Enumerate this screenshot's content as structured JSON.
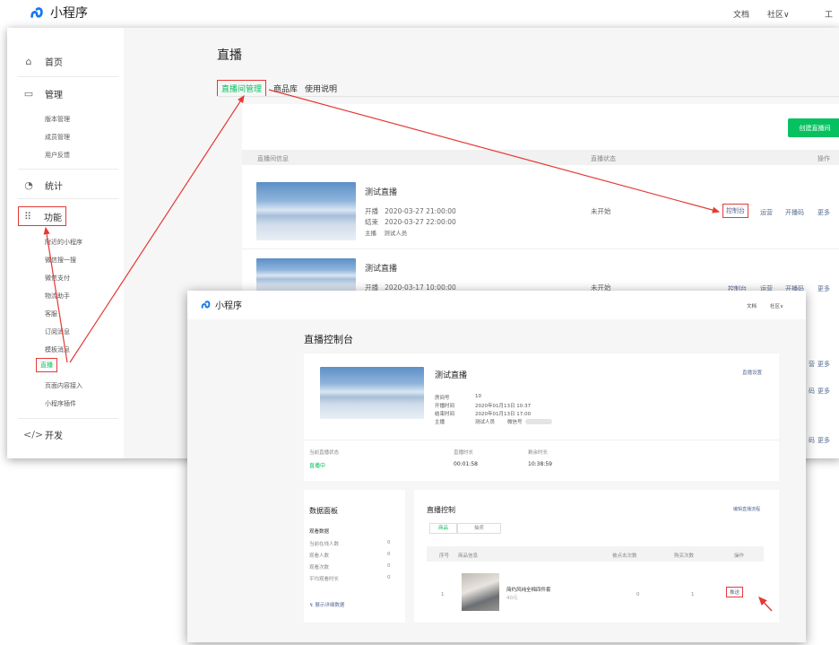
{
  "topbar": {
    "app_name": "小程序",
    "links": [
      "文档",
      "社区∨",
      "工"
    ]
  },
  "sidebar": {
    "home": "首页",
    "manage": "管理",
    "manage_items": [
      "版本管理",
      "成员管理",
      "用户反馈"
    ],
    "stats": "统计",
    "features": "功能",
    "feature_items": [
      "附近的小程序",
      "微信搜一搜",
      "微信支付",
      "物流助手",
      "客服",
      "订阅消息",
      "模板消息",
      "直播",
      "页面内容接入",
      "小程序插件"
    ],
    "dev": "开发"
  },
  "main": {
    "title": "直播",
    "tabs": [
      "直播间管理",
      "商品库",
      "使用说明"
    ],
    "create_button": "创建直播间",
    "table_headers": [
      "直播间信息",
      "直播状态",
      "操作"
    ],
    "rows": [
      {
        "name": "测试直播",
        "start_label": "开播",
        "start": "2020-03-27 21:00:00",
        "end_label": "结束",
        "end": "2020-03-27 22:00:00",
        "host_label": "主播",
        "host": "测试人员",
        "status": "未开始",
        "actions": [
          "控制台",
          "运营",
          "开播码",
          "更多"
        ]
      },
      {
        "name": "测试直播",
        "start_label": "开播",
        "start": "2020-03-17 10:00:00",
        "status": "未开始",
        "actions": [
          "控制台",
          "运营",
          "开播码",
          "更多"
        ]
      }
    ],
    "more_partial": [
      "更多",
      "更多",
      "更多"
    ],
    "op_partial": [
      "营",
      "码",
      "码"
    ]
  },
  "console": {
    "app_name": "小程序",
    "links": [
      "文档",
      "社区∨"
    ],
    "title": "直播控制台",
    "live_name": "测试直播",
    "settings_link": "直播设置",
    "info": [
      {
        "k": "房间号",
        "v": "10"
      },
      {
        "k": "开播时间",
        "v": "2020年01月13日 10:37"
      },
      {
        "k": "结束时间",
        "v": "2020年01月13日 17:00"
      },
      {
        "k": "主播",
        "v": "测试人员"
      }
    ],
    "wechat_label": "微信号",
    "stats": [
      {
        "k": "当前直播状态",
        "v": "直播中"
      },
      {
        "k": "直播时长",
        "v": "00:01:58"
      },
      {
        "k": "剩余时长",
        "v": "10:38:59"
      }
    ],
    "data_panel": {
      "title": "数据面板",
      "subtitle": "观看数据",
      "rows": [
        {
          "k": "当前在线人数",
          "v": "0"
        },
        {
          "k": "观看人数",
          "v": "0"
        },
        {
          "k": "观看次数",
          "v": "0"
        },
        {
          "k": "平均观看时长",
          "v": "0"
        }
      ],
      "more": "展示详细数据"
    },
    "control": {
      "title": "直播控制",
      "link": "编辑直播流程",
      "tabs": [
        "商品",
        "抽奖"
      ],
      "headers": [
        "序号",
        "商品信息",
        "被点击次数",
        "购买次数",
        "操作"
      ],
      "item": {
        "index": "1",
        "name": "简约风纯全棉四件套",
        "price": "40元",
        "clicks": "0",
        "buys": "1",
        "action": "推送"
      }
    }
  },
  "colors": {
    "accent": "#07c160",
    "highlight": "#e53935",
    "link": "#576b95"
  }
}
